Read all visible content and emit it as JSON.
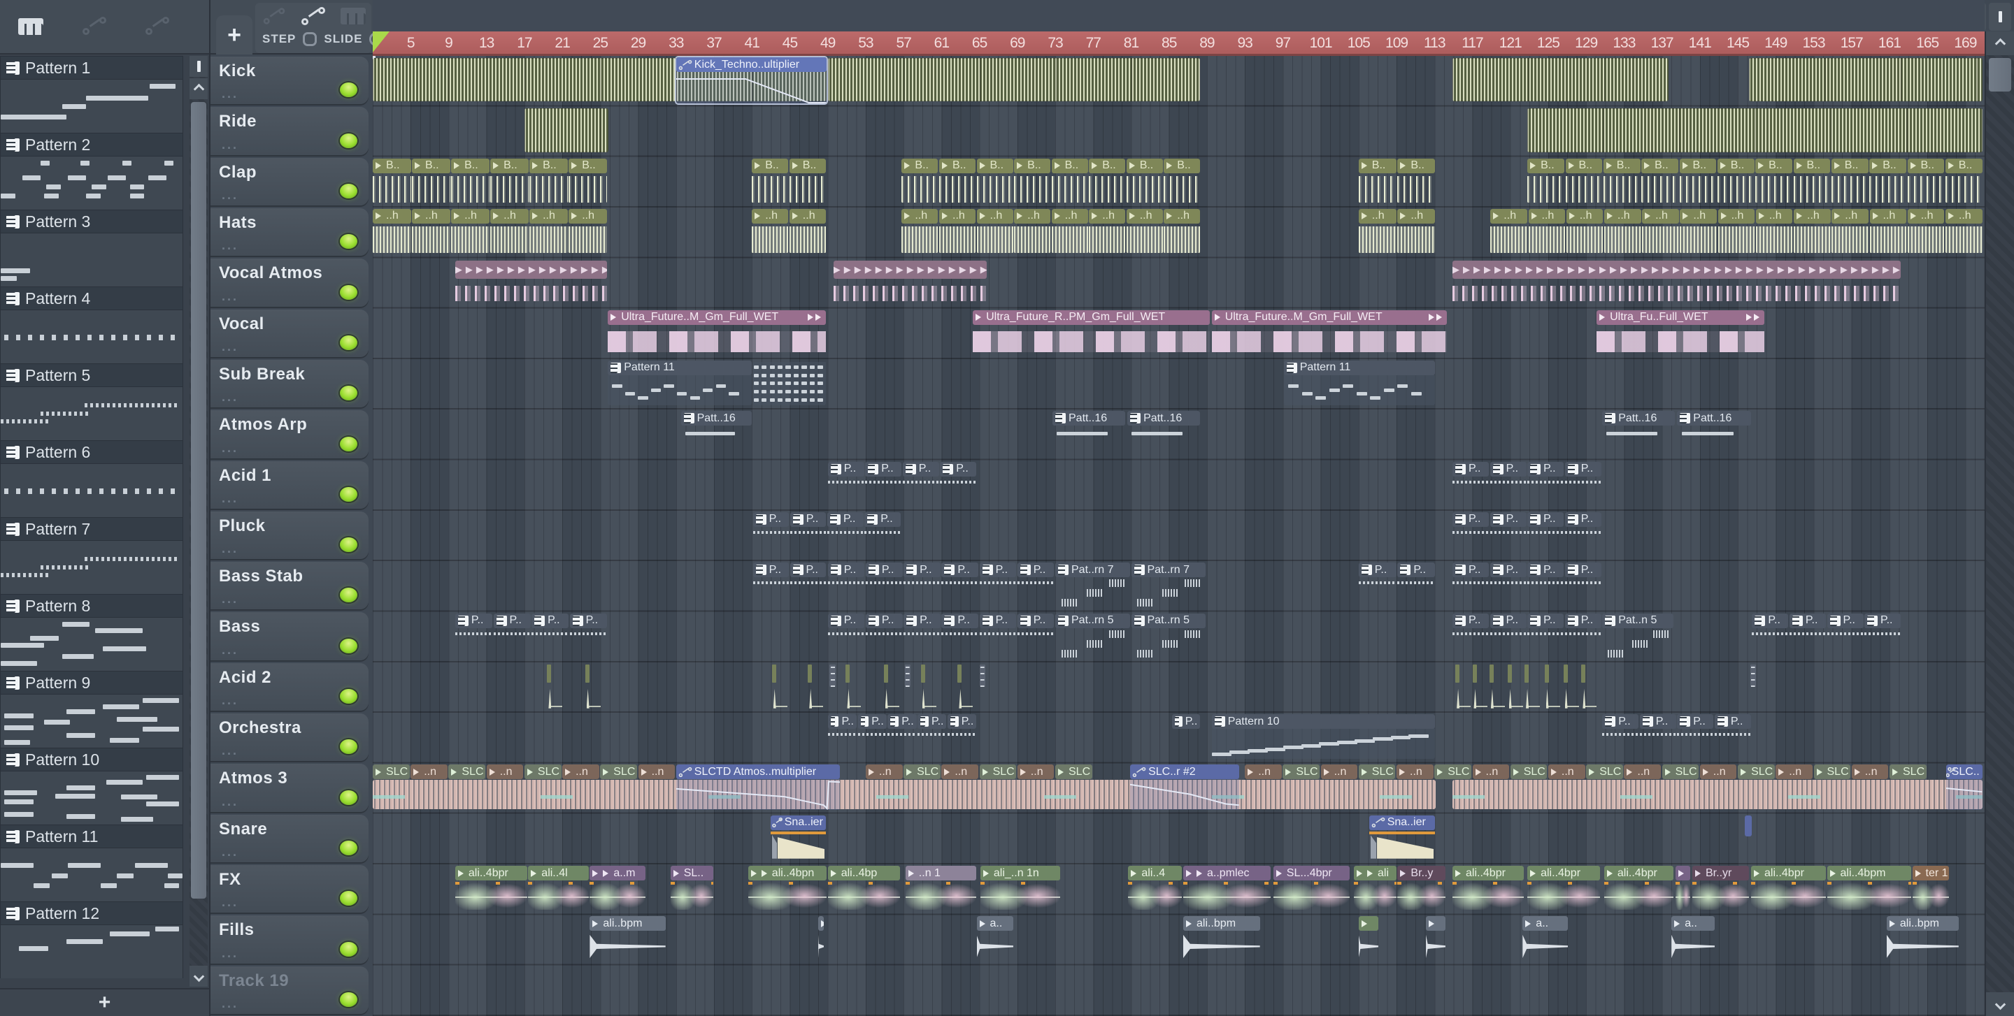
{
  "icons": {
    "add": "+",
    "picker_handle": "|"
  },
  "toolbar": {
    "step": "STEP",
    "slide": "SLIDE"
  },
  "colors": {
    "ruler": "#b96464",
    "led": "#9ade2f",
    "olive_clip": "#7f8758",
    "mauve_clip": "#8d7186",
    "vocal_clip": "#996f8e",
    "midi_clip": "#4d5664",
    "automation_clip": "#5b6aa6",
    "fx_green": "#6f8765",
    "fx_purple": "#776386",
    "atmos_slc": "#6d7968",
    "atmos_n": "#7c665a"
  },
  "timeline": {
    "first_label": 5,
    "step": 4,
    "last_label": 169,
    "total_bars": 170.9
  },
  "picker": {
    "patterns": [
      {
        "name": "Pattern 1",
        "kind": "dashes",
        "rows": [
          [
            82,
            8,
            14
          ],
          [
            47,
            30,
            34
          ],
          [
            34,
            46,
            13
          ],
          [
            0,
            66,
            36
          ]
        ]
      },
      {
        "name": "Pattern 2",
        "kind": "dashes",
        "rows": [
          [
            22,
            8,
            5
          ],
          [
            44,
            8,
            5
          ],
          [
            67,
            8,
            5
          ],
          [
            90,
            8,
            5
          ],
          [
            12,
            36,
            10
          ],
          [
            25,
            52,
            8
          ],
          [
            37,
            36,
            10
          ],
          [
            50,
            52,
            8
          ],
          [
            59,
            36,
            10
          ],
          [
            71,
            52,
            8
          ],
          [
            81,
            36,
            10
          ],
          [
            0,
            70,
            8
          ],
          [
            24,
            70,
            8
          ],
          [
            47,
            70,
            8
          ],
          [
            71,
            70,
            8
          ]
        ]
      },
      {
        "name": "Pattern 3",
        "kind": "dashes",
        "rows": [
          [
            0,
            66,
            16
          ],
          [
            0,
            80,
            9
          ]
        ]
      },
      {
        "name": "Pattern 4",
        "kind": "dots",
        "y": 46
      },
      {
        "name": "Pattern 5",
        "kind": "dotrows",
        "rows": [
          [
            46,
            30,
            52
          ],
          [
            22,
            46,
            26
          ],
          [
            0,
            60,
            26
          ]
        ]
      },
      {
        "name": "Pattern 6",
        "kind": "dots",
        "y": 46
      },
      {
        "name": "Pattern 7",
        "kind": "dotrows",
        "rows": [
          [
            46,
            30,
            52
          ],
          [
            22,
            46,
            26
          ],
          [
            0,
            60,
            26
          ]
        ]
      },
      {
        "name": "Pattern 8",
        "kind": "dashes",
        "rows": [
          [
            34,
            8,
            15
          ],
          [
            52,
            20,
            26
          ],
          [
            16,
            34,
            16
          ],
          [
            0,
            48,
            24
          ],
          [
            56,
            54,
            24
          ],
          [
            34,
            68,
            17
          ],
          [
            0,
            82,
            20
          ]
        ]
      },
      {
        "name": "Pattern 9",
        "kind": "dashes",
        "rows": [
          [
            78,
            6,
            20
          ],
          [
            56,
            18,
            20
          ],
          [
            36,
            28,
            16
          ],
          [
            2,
            36,
            16
          ],
          [
            64,
            42,
            22
          ],
          [
            24,
            48,
            14
          ],
          [
            2,
            58,
            16
          ],
          [
            78,
            60,
            20
          ],
          [
            36,
            72,
            16
          ],
          [
            60,
            82,
            16
          ],
          [
            2,
            86,
            14
          ]
        ]
      },
      {
        "name": "Pattern 10",
        "kind": "dashes",
        "rows": [
          [
            80,
            6,
            18
          ],
          [
            58,
            16,
            20
          ],
          [
            36,
            26,
            16
          ],
          [
            2,
            36,
            18
          ],
          [
            30,
            42,
            22
          ],
          [
            66,
            44,
            20
          ],
          [
            2,
            52,
            16
          ],
          [
            80,
            56,
            18
          ],
          [
            2,
            76,
            16
          ],
          [
            36,
            80,
            16
          ],
          [
            66,
            86,
            18
          ]
        ]
      },
      {
        "name": "Pattern 11",
        "kind": "dashes",
        "rows": [
          [
            0,
            28,
            18
          ],
          [
            37,
            28,
            18
          ],
          [
            74,
            28,
            18
          ],
          [
            28,
            48,
            9
          ],
          [
            64,
            48,
            9
          ],
          [
            92,
            48,
            8
          ],
          [
            18,
            66,
            9
          ],
          [
            55,
            66,
            9
          ],
          [
            90,
            66,
            8
          ]
        ]
      },
      {
        "name": "Pattern 12",
        "kind": "dashes",
        "rows": [
          [
            85,
            2,
            13
          ],
          [
            60,
            12,
            22
          ],
          [
            36,
            26,
            20
          ],
          [
            10,
            40,
            16
          ]
        ]
      }
    ]
  },
  "tracks": [
    {
      "name": "Kick",
      "dim": false
    },
    {
      "name": "Ride",
      "dim": false
    },
    {
      "name": "Clap",
      "dim": false
    },
    {
      "name": "Hats",
      "dim": false
    },
    {
      "name": "Vocal Atmos",
      "dim": false
    },
    {
      "name": "Vocal",
      "dim": false
    },
    {
      "name": "Sub Break",
      "dim": false
    },
    {
      "name": "Atmos Arp",
      "dim": false
    },
    {
      "name": "Acid 1",
      "dim": false
    },
    {
      "name": "Pluck",
      "dim": false
    },
    {
      "name": "Bass Stab",
      "dim": false
    },
    {
      "name": "Bass",
      "dim": false
    },
    {
      "name": "Acid 2",
      "dim": false
    },
    {
      "name": "Orchestra",
      "dim": false
    },
    {
      "name": "Atmos 3",
      "dim": false
    },
    {
      "name": "Snare",
      "dim": false
    },
    {
      "name": "FX",
      "dim": false
    },
    {
      "name": "Fills",
      "dim": false
    },
    {
      "name": "Track 19",
      "dim": true
    }
  ],
  "clips": {
    "kick_audio": [
      [
        1,
        49
      ],
      [
        49,
        88.4
      ],
      [
        114.9,
        137.8
      ],
      [
        146.2,
        170.9
      ]
    ],
    "kick_automation": {
      "start": 33,
      "end": 49,
      "label": "Kick_Techno..ultiplier",
      "selected": true,
      "curve": "0,22 46,22 88,97 100,97"
    },
    "ride_audio": [
      [
        17,
        26
      ],
      [
        122.8,
        170.9
      ]
    ],
    "clap": {
      "label": "B..",
      "runs": [
        [
          1,
          25.8,
          6
        ],
        [
          41,
          48.9,
          2
        ],
        [
          56.8,
          88.4,
          8
        ],
        [
          105,
          113.2,
          2
        ],
        [
          122.8,
          170.9,
          12
        ]
      ]
    },
    "hats": {
      "label": "..h",
      "runs": [
        [
          1,
          25.8,
          6
        ],
        [
          41,
          48.9,
          2
        ],
        [
          56.8,
          88.4,
          8
        ],
        [
          105,
          113.2,
          2
        ],
        [
          118.9,
          170.9,
          13
        ]
      ]
    },
    "vocal_atmos": [
      [
        9.7,
        25.8
      ],
      [
        49.6,
        65.9
      ],
      [
        114.9,
        162.3
      ]
    ],
    "vocal": [
      {
        "s": 25.8,
        "e": 48.9,
        "label": "Ultra_Future..M_Gm_Full_WET",
        "tail": true
      },
      {
        "s": 64.3,
        "e": 89.4,
        "label": "Ultra_Future_R..PM_Gm_Full_WET",
        "tail": false
      },
      {
        "s": 89.5,
        "e": 114.4,
        "label": "Ultra_Future..M_Gm_Full_WET",
        "tail": true
      },
      {
        "s": 130.1,
        "e": 147.9,
        "label": "Ultra_Fu..Full_WET",
        "tail": true
      }
    ],
    "sub_break": [
      {
        "s": 25.8,
        "e": 41.1,
        "label": "Pattern 11",
        "notes": "melody"
      },
      {
        "s": 41.1,
        "e": 48.9,
        "label": "",
        "notes": "dense"
      },
      {
        "s": 97.1,
        "e": 113.2,
        "label": "Pattern 11",
        "notes": "melody"
      }
    ],
    "atmos_arp": {
      "label": "Patt..16",
      "spans": [
        [
          33.5,
          41.1
        ],
        [
          72.7,
          80.5
        ],
        [
          80.6,
          88.4
        ],
        [
          130.7,
          138.5
        ],
        [
          138.6,
          146.5
        ]
      ]
    },
    "acid1": {
      "label": "P..",
      "runs": [
        [
          49,
          64.8,
          4
        ],
        [
          114.9,
          130.7,
          4
        ]
      ]
    },
    "pluck": {
      "label": "P..",
      "runs": [
        [
          41.1,
          56.8,
          4
        ],
        [
          114.9,
          130.7,
          4
        ]
      ]
    },
    "bass_stab": {
      "label": "P..",
      "runs": [
        [
          41.1,
          48.9,
          2
        ],
        [
          49,
          73,
          6
        ],
        [
          105,
          113.2,
          2
        ],
        [
          114.9,
          130.7,
          4
        ]
      ],
      "big": [
        [
          73,
          81,
          "Pat..rn 7"
        ],
        [
          81,
          89,
          "Pat..rn 7"
        ]
      ]
    },
    "bass": {
      "label": "P..",
      "runs": [
        [
          9.7,
          25.8,
          4
        ],
        [
          49,
          73,
          6
        ],
        [
          114.9,
          130.7,
          4
        ],
        [
          146.5,
          162.3,
          4
        ]
      ],
      "big": [
        [
          73,
          81,
          "Pat..rn 5"
        ],
        [
          81,
          89,
          "Pat..rn 5"
        ],
        [
          130.7,
          138.3,
          "Pat..n 5"
        ]
      ]
    },
    "acid2": {
      "green": [
        19.4,
        23.4,
        43.1,
        46.9,
        50.9,
        54.9,
        58.8,
        62.7,
        115.2,
        117,
        118.8,
        120.7,
        122.5,
        124.6,
        126.6,
        128.5
      ],
      "gray": [
        49.2,
        57.1,
        65,
        146.3
      ]
    },
    "orchestra": {
      "label": "P..",
      "runs": [
        [
          49,
          64.8,
          5
        ],
        [
          130.7,
          146.5,
          4
        ]
      ],
      "small": [
        [
          85.3,
          88.4
        ]
      ],
      "big": [
        [
          89.5,
          113.2,
          "Pattern 10"
        ]
      ]
    },
    "atmos3": {
      "wave": [
        [
          1,
          113.2
        ],
        [
          114.9,
          170.9
        ]
      ],
      "header_start": 1,
      "header_end": 167,
      "labels": [
        "SLC",
        "..n"
      ],
      "autos": [
        {
          "s": 33,
          "e": 50.4,
          "label": "SLCTD Atmos..multiplier",
          "curve": "0,32 66,58 90,86 92,97 93,8 100,10"
        },
        {
          "s": 80.9,
          "e": 92.5,
          "label": "SLC..r #2",
          "curve": "0,18 55,50 88,82 100,86"
        },
        {
          "s": 167,
          "e": 170.9,
          "label": "SLC..",
          "curve": "0,30 100,42"
        }
      ]
    },
    "snare": {
      "autos": [
        {
          "s": 43,
          "e": 48.9,
          "label": "Sna..ier"
        },
        {
          "s": 106.1,
          "e": 113.2,
          "label": "Sna..ier"
        }
      ],
      "sliver": [
        145.7,
        146.6
      ]
    },
    "fx": [
      [
        9.7,
        17.4,
        "ali..4bpr",
        "g",
        0
      ],
      [
        17.4,
        23.9,
        "ali..4l",
        "g",
        0
      ],
      [
        23.9,
        29.9,
        "a..m",
        "p",
        1
      ],
      [
        32.4,
        37,
        "SL..",
        "p",
        0
      ],
      [
        40.6,
        49,
        "ali..4bpn",
        "g",
        1
      ],
      [
        49,
        56.7,
        "ali..4bp",
        "g",
        0
      ],
      [
        57.2,
        64.8,
        "..n 1",
        "pf",
        0
      ],
      [
        65.1,
        73.6,
        "ali_..n 1n",
        "g",
        0
      ],
      [
        80.7,
        86.5,
        "ali..4",
        "g",
        0
      ],
      [
        86.5,
        95.8,
        "a..pmlec",
        "p",
        1
      ],
      [
        96,
        104.2,
        "SL...4bpr",
        "p",
        0
      ],
      [
        104.5,
        109.1,
        "ali",
        "g",
        1
      ],
      [
        109.1,
        114.3,
        "Br..y",
        "pd",
        0
      ],
      [
        114.9,
        122.5,
        "ali..4bpr",
        "g",
        0
      ],
      [
        122.8,
        130.6,
        "ali..4bpr",
        "g",
        0
      ],
      [
        130.9,
        138.3,
        "ali..4bpr",
        "g",
        0
      ],
      [
        138.4,
        140.1,
        "",
        "p",
        0
      ],
      [
        140.2,
        146.3,
        "Br..yr",
        "pd",
        0
      ],
      [
        146.4,
        154.4,
        "ali..4bpr",
        "g",
        0
      ],
      [
        154.4,
        163.4,
        "ali..4bpm",
        "g",
        0
      ],
      [
        163.4,
        167.4,
        "ter 1",
        "br",
        0
      ]
    ],
    "fills": [
      [
        23.9,
        32,
        "ali..bpm",
        "n"
      ],
      [
        48,
        48.7,
        "",
        "n"
      ],
      [
        64.7,
        68.7,
        "a..",
        "n"
      ],
      [
        86.5,
        94.7,
        "ali..bpm",
        "n"
      ],
      [
        105,
        107.2,
        "",
        "gr"
      ],
      [
        112.1,
        114.3,
        "",
        "n"
      ],
      [
        122.3,
        127.2,
        "a..",
        "n"
      ],
      [
        138,
        142.7,
        "a..",
        "n"
      ],
      [
        160.7,
        168.4,
        "ali..bpm",
        "n"
      ]
    ]
  }
}
